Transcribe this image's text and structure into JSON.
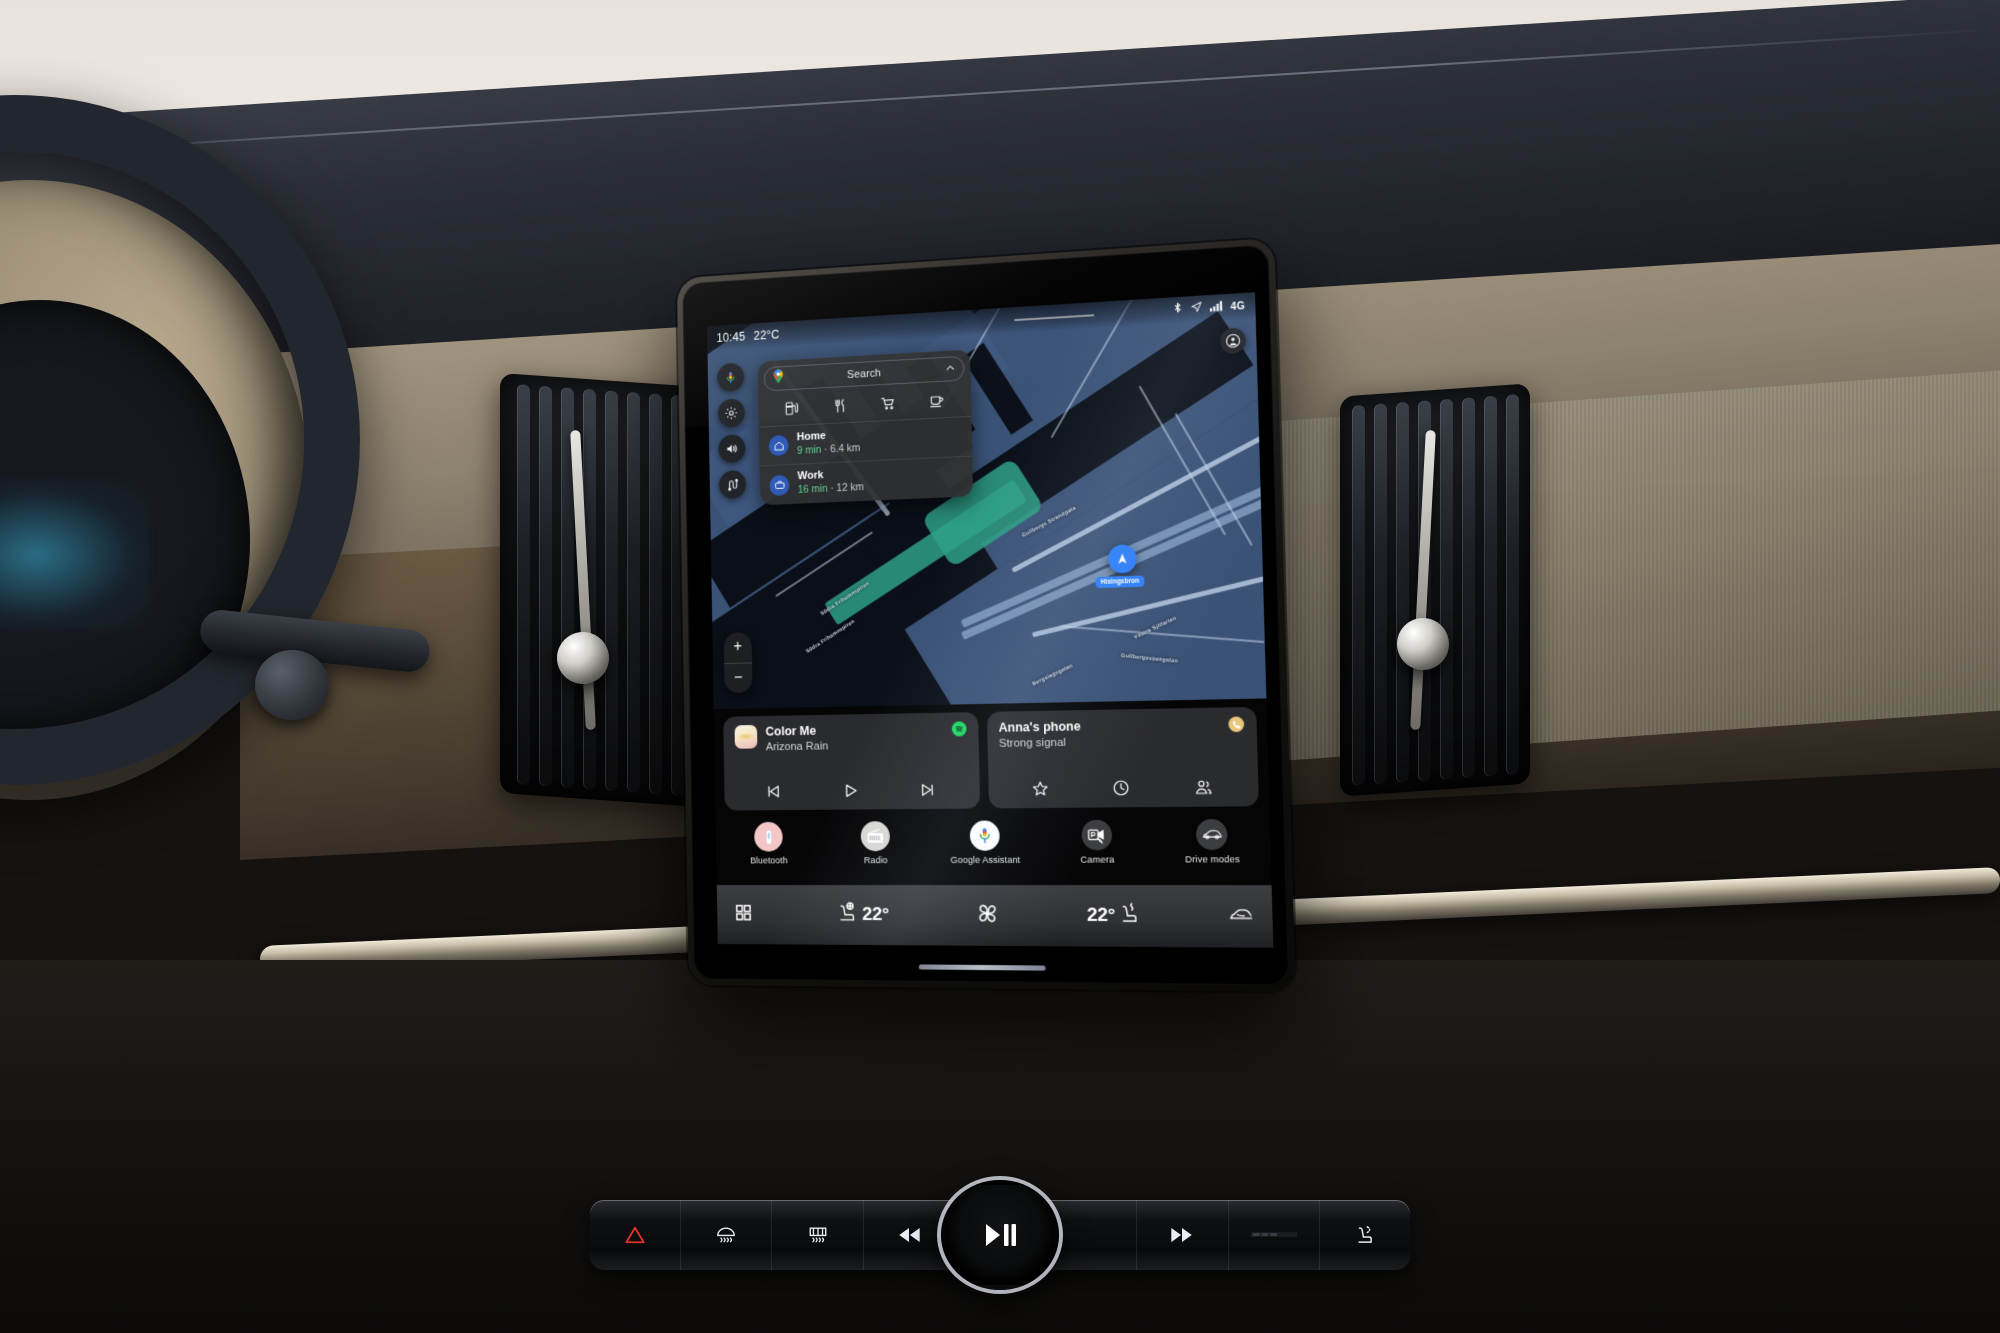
{
  "status_bar": {
    "time": "10:45",
    "temperature": "22°C",
    "icons": [
      "bluetooth-icon",
      "location-arrow-icon",
      "signal-bars-icon"
    ],
    "network": "4G"
  },
  "map": {
    "left_rail": [
      {
        "name": "google-assistant-mic",
        "label": "Google Assistant"
      },
      {
        "name": "settings-gear",
        "label": "Settings"
      },
      {
        "name": "volume-speaker",
        "label": "Volume"
      },
      {
        "name": "route-overview",
        "label": "Route"
      }
    ],
    "avatar_button": "account-avatar",
    "zoom_in": "+",
    "zoom_out": "−",
    "marker_label": "Hisingsbron",
    "street_labels": [
      "Södra Frihamnspiren",
      "Södra Frihamnspiren",
      "Västra Sjöfarten",
      "Gullbergs Strandgata",
      "Gullbergsvassgatan",
      "Bergslagsgatan"
    ]
  },
  "search_panel": {
    "app_icon": "google-maps-pin",
    "placeholder": "Search",
    "collapse_icon": "chevron-up-icon",
    "quick_actions": [
      {
        "name": "gas-station-icon",
        "label": "Gas"
      },
      {
        "name": "restaurant-icon",
        "label": "Restaurants"
      },
      {
        "name": "grocery-cart-icon",
        "label": "Groceries"
      },
      {
        "name": "coffee-cup-icon",
        "label": "Coffee"
      }
    ],
    "destinations": [
      {
        "icon": "home-icon",
        "name": "Home",
        "time": "9 min",
        "sep": " · ",
        "distance": "6.4 km"
      },
      {
        "icon": "work-briefcase-icon",
        "name": "Work",
        "time": "16 min",
        "sep": " · ",
        "distance": "12 km"
      }
    ]
  },
  "media_card": {
    "title": "Color Me",
    "artist": "Arizona Rain",
    "source_badge": "spotify-icon",
    "controls": [
      {
        "name": "previous-track-button",
        "glyph": "prev"
      },
      {
        "name": "play-button",
        "glyph": "play"
      },
      {
        "name": "next-track-button",
        "glyph": "next"
      }
    ]
  },
  "phone_card": {
    "title": "Anna's phone",
    "subtitle": "Strong signal",
    "source_badge": "phone-handset-icon",
    "controls": [
      {
        "name": "favorites-star-button",
        "glyph": "star"
      },
      {
        "name": "recent-calls-button",
        "glyph": "clock"
      },
      {
        "name": "contacts-button",
        "glyph": "contacts"
      }
    ]
  },
  "app_row": [
    {
      "icon": "bluetooth-icon",
      "label": "Bluetooth"
    },
    {
      "icon": "radio-icon",
      "label": "Radio"
    },
    {
      "icon": "google-assistant-icon",
      "label": "Google Assistant"
    },
    {
      "icon": "camera-icon",
      "label": "Camera"
    },
    {
      "icon": "drive-modes-car-icon",
      "label": "Drive modes"
    }
  ],
  "climate_bar": {
    "apps_grid": "apps-grid-icon",
    "driver_temp": "22°",
    "driver_icon": "driver-seat-heat-icon",
    "fan_icon": "fan-icon",
    "passenger_temp": "22°",
    "passenger_icon": "passenger-seat-heat-icon",
    "defrost_icon": "windshield-defrost-icon"
  },
  "physical_panel": {
    "buttons": [
      {
        "name": "hazard-lights-button",
        "glyph": "hazard"
      },
      {
        "name": "front-defrost-button",
        "glyph": "front-defrost"
      },
      {
        "name": "rear-defrost-button",
        "glyph": "rear-defrost"
      },
      {
        "name": "previous-track-button",
        "glyph": "prev"
      },
      {
        "name": "next-track-button",
        "glyph": "next"
      },
      {
        "name": "speaker-grille",
        "glyph": "grille"
      },
      {
        "name": "rear-seat-button",
        "glyph": "rear-seat"
      }
    ],
    "center_knob": {
      "name": "play-pause-knob",
      "glyph": "play-pause"
    }
  },
  "colors": {
    "accent_blue": "#2d7ff9",
    "eta_green": "#62d68f",
    "spotify_green": "#1ed760",
    "phone_gold": "#e8c67a",
    "map_land": "#3f587f",
    "map_water": "#0a0f18",
    "quay_teal": "#2ea086",
    "card_bg": "#2a2b2e",
    "panel_bg": "#2f3033"
  }
}
